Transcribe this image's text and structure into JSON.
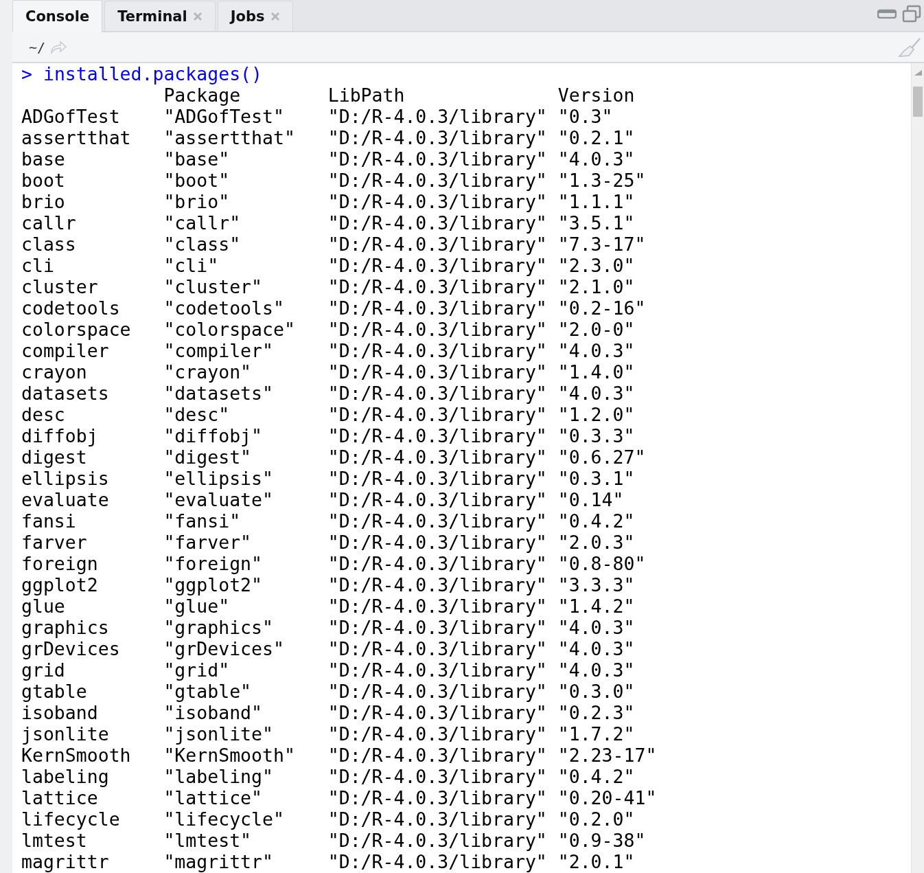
{
  "tabs": [
    {
      "label": "Console",
      "selected": true,
      "closable": false
    },
    {
      "label": "Terminal",
      "selected": false,
      "closable": true
    },
    {
      "label": "Jobs",
      "selected": false,
      "closable": true
    }
  ],
  "toolbar": {
    "path": "~/"
  },
  "console": {
    "prompt": ">",
    "command": "installed.packages()",
    "columns": [
      "Package",
      "LibPath",
      "Version"
    ],
    "rows": [
      {
        "name": "ADGofTest",
        "package": "\"ADGofTest\"",
        "libpath": "\"D:/R-4.0.3/library\"",
        "version": "\"0.3\""
      },
      {
        "name": "assertthat",
        "package": "\"assertthat\"",
        "libpath": "\"D:/R-4.0.3/library\"",
        "version": "\"0.2.1\""
      },
      {
        "name": "base",
        "package": "\"base\"",
        "libpath": "\"D:/R-4.0.3/library\"",
        "version": "\"4.0.3\""
      },
      {
        "name": "boot",
        "package": "\"boot\"",
        "libpath": "\"D:/R-4.0.3/library\"",
        "version": "\"1.3-25\""
      },
      {
        "name": "brio",
        "package": "\"brio\"",
        "libpath": "\"D:/R-4.0.3/library\"",
        "version": "\"1.1.1\""
      },
      {
        "name": "callr",
        "package": "\"callr\"",
        "libpath": "\"D:/R-4.0.3/library\"",
        "version": "\"3.5.1\""
      },
      {
        "name": "class",
        "package": "\"class\"",
        "libpath": "\"D:/R-4.0.3/library\"",
        "version": "\"7.3-17\""
      },
      {
        "name": "cli",
        "package": "\"cli\"",
        "libpath": "\"D:/R-4.0.3/library\"",
        "version": "\"2.3.0\""
      },
      {
        "name": "cluster",
        "package": "\"cluster\"",
        "libpath": "\"D:/R-4.0.3/library\"",
        "version": "\"2.1.0\""
      },
      {
        "name": "codetools",
        "package": "\"codetools\"",
        "libpath": "\"D:/R-4.0.3/library\"",
        "version": "\"0.2-16\""
      },
      {
        "name": "colorspace",
        "package": "\"colorspace\"",
        "libpath": "\"D:/R-4.0.3/library\"",
        "version": "\"2.0-0\""
      },
      {
        "name": "compiler",
        "package": "\"compiler\"",
        "libpath": "\"D:/R-4.0.3/library\"",
        "version": "\"4.0.3\""
      },
      {
        "name": "crayon",
        "package": "\"crayon\"",
        "libpath": "\"D:/R-4.0.3/library\"",
        "version": "\"1.4.0\""
      },
      {
        "name": "datasets",
        "package": "\"datasets\"",
        "libpath": "\"D:/R-4.0.3/library\"",
        "version": "\"4.0.3\""
      },
      {
        "name": "desc",
        "package": "\"desc\"",
        "libpath": "\"D:/R-4.0.3/library\"",
        "version": "\"1.2.0\""
      },
      {
        "name": "diffobj",
        "package": "\"diffobj\"",
        "libpath": "\"D:/R-4.0.3/library\"",
        "version": "\"0.3.3\""
      },
      {
        "name": "digest",
        "package": "\"digest\"",
        "libpath": "\"D:/R-4.0.3/library\"",
        "version": "\"0.6.27\""
      },
      {
        "name": "ellipsis",
        "package": "\"ellipsis\"",
        "libpath": "\"D:/R-4.0.3/library\"",
        "version": "\"0.3.1\""
      },
      {
        "name": "evaluate",
        "package": "\"evaluate\"",
        "libpath": "\"D:/R-4.0.3/library\"",
        "version": "\"0.14\""
      },
      {
        "name": "fansi",
        "package": "\"fansi\"",
        "libpath": "\"D:/R-4.0.3/library\"",
        "version": "\"0.4.2\""
      },
      {
        "name": "farver",
        "package": "\"farver\"",
        "libpath": "\"D:/R-4.0.3/library\"",
        "version": "\"2.0.3\""
      },
      {
        "name": "foreign",
        "package": "\"foreign\"",
        "libpath": "\"D:/R-4.0.3/library\"",
        "version": "\"0.8-80\""
      },
      {
        "name": "ggplot2",
        "package": "\"ggplot2\"",
        "libpath": "\"D:/R-4.0.3/library\"",
        "version": "\"3.3.3\""
      },
      {
        "name": "glue",
        "package": "\"glue\"",
        "libpath": "\"D:/R-4.0.3/library\"",
        "version": "\"1.4.2\""
      },
      {
        "name": "graphics",
        "package": "\"graphics\"",
        "libpath": "\"D:/R-4.0.3/library\"",
        "version": "\"4.0.3\""
      },
      {
        "name": "grDevices",
        "package": "\"grDevices\"",
        "libpath": "\"D:/R-4.0.3/library\"",
        "version": "\"4.0.3\""
      },
      {
        "name": "grid",
        "package": "\"grid\"",
        "libpath": "\"D:/R-4.0.3/library\"",
        "version": "\"4.0.3\""
      },
      {
        "name": "gtable",
        "package": "\"gtable\"",
        "libpath": "\"D:/R-4.0.3/library\"",
        "version": "\"0.3.0\""
      },
      {
        "name": "isoband",
        "package": "\"isoband\"",
        "libpath": "\"D:/R-4.0.3/library\"",
        "version": "\"0.2.3\""
      },
      {
        "name": "jsonlite",
        "package": "\"jsonlite\"",
        "libpath": "\"D:/R-4.0.3/library\"",
        "version": "\"1.7.2\""
      },
      {
        "name": "KernSmooth",
        "package": "\"KernSmooth\"",
        "libpath": "\"D:/R-4.0.3/library\"",
        "version": "\"2.23-17\""
      },
      {
        "name": "labeling",
        "package": "\"labeling\"",
        "libpath": "\"D:/R-4.0.3/library\"",
        "version": "\"0.4.2\""
      },
      {
        "name": "lattice",
        "package": "\"lattice\"",
        "libpath": "\"D:/R-4.0.3/library\"",
        "version": "\"0.20-41\""
      },
      {
        "name": "lifecycle",
        "package": "\"lifecycle\"",
        "libpath": "\"D:/R-4.0.3/library\"",
        "version": "\"0.2.0\""
      },
      {
        "name": "lmtest",
        "package": "\"lmtest\"",
        "libpath": "\"D:/R-4.0.3/library\"",
        "version": "\"0.9-38\""
      },
      {
        "name": "magrittr",
        "package": "\"magrittr\"",
        "libpath": "\"D:/R-4.0.3/library\"",
        "version": "\"2.0.1\""
      }
    ]
  }
}
